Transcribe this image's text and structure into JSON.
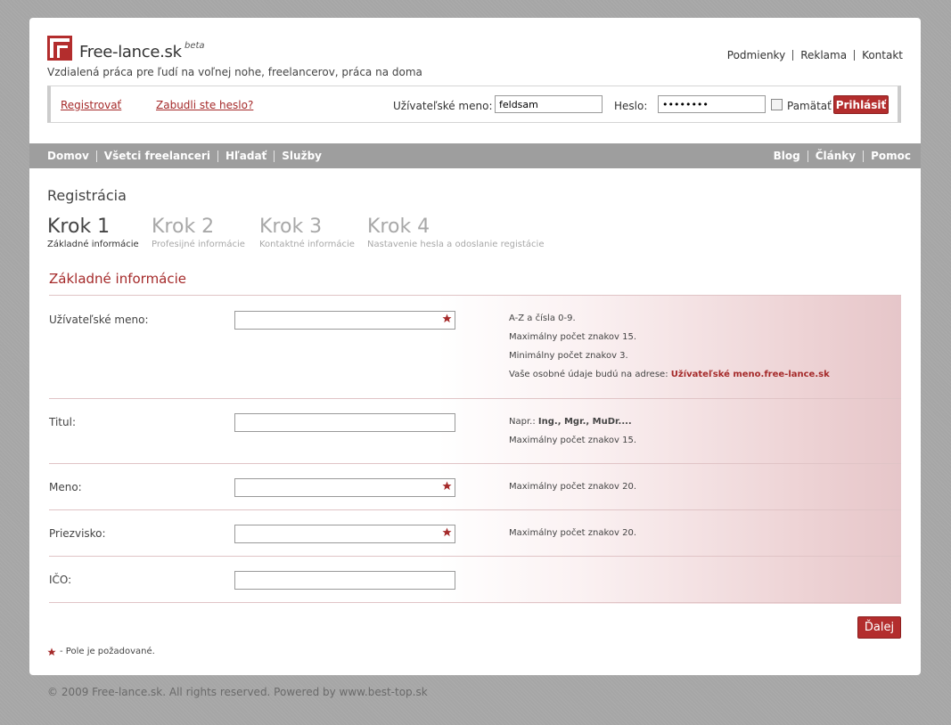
{
  "header": {
    "logo_text": "Free-lance.sk",
    "logo_beta": "beta",
    "tagline": "Vzdialená práca pre ľudí na voľnej nohe, freelancerov, práca na doma",
    "top_links": [
      "Podmienky",
      "Reklama",
      "Kontakt"
    ]
  },
  "login": {
    "register_link": "Registrovať",
    "forgot_link": "Zabudli ste heslo?",
    "username_label": "Užívateľské meno:",
    "username_value": "feldsam",
    "password_label": "Heslo:",
    "password_value": "password",
    "remember_label": "Pamätať",
    "login_button": "Prihlásiť"
  },
  "nav": {
    "left": [
      "Domov",
      "Všetci freelanceri",
      "Hľadať",
      "Služby"
    ],
    "right": [
      "Blog",
      "Články",
      "Pomoc"
    ]
  },
  "registration": {
    "title": "Registrácia",
    "steps": [
      {
        "title": "Krok 1",
        "subtitle": "Základné informácie"
      },
      {
        "title": "Krok 2",
        "subtitle": "Profesijné informácie"
      },
      {
        "title": "Krok 3",
        "subtitle": "Kontaktné informácie"
      },
      {
        "title": "Krok 4",
        "subtitle": "Nastavenie hesla a odoslanie registácie"
      }
    ],
    "section_title": "Základné informácie",
    "fields": {
      "username": {
        "label": "Užívateľské meno:",
        "hint1": "A-Z a čísla 0-9.",
        "hint2": "Maximálny počet znakov 15.",
        "hint3": "Minimálny počet znakov 3.",
        "hint4_prefix": "Vaše osobné údaje budú na adrese: ",
        "hint4_bold": "Užívateľské meno.free-lance.sk"
      },
      "title": {
        "label": "Titul:",
        "hint1_prefix": "Napr.: ",
        "hint1_bold": "Ing., Mgr., MuDr....",
        "hint2": "Maximálny počet znakov 15."
      },
      "first_name": {
        "label": "Meno:",
        "hint1": "Maximálny počet znakov 20."
      },
      "surname": {
        "label": "Priezvisko:",
        "hint1": "Maximálny počet znakov 20."
      },
      "ico": {
        "label": "IČO:"
      }
    },
    "next_button": "Ďalej",
    "required_legend": "- Pole je požadované."
  },
  "footer": {
    "text": "© 2009 Free-lance.sk. All rights reserved. Powered by www.best-top.sk"
  },
  "colors": {
    "accent": "#b32d2d",
    "link": "#a52a2a",
    "nav_bg": "#9e9e9e"
  }
}
